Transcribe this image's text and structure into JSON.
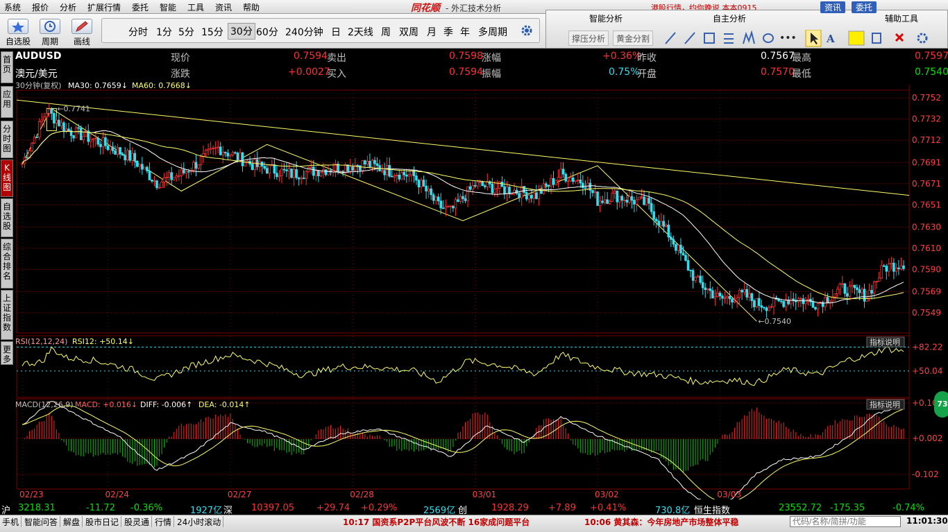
{
  "menu": [
    "系统",
    "报价",
    "分析",
    "扩展行情",
    "委托",
    "智能",
    "工具",
    "资讯",
    "帮助"
  ],
  "app": {
    "logo": "同花顺",
    "title": "- 外汇技术分析",
    "ticker": "港股行情，约你晚说  本本0915"
  },
  "toolbar": {
    "buttons": [
      "自选股",
      "周期",
      "画线"
    ],
    "periods": [
      "分时",
      "1分",
      "5分",
      "15分",
      "30分",
      "60分",
      "240分钟",
      "日",
      "2天线",
      "周",
      "双周",
      "月",
      "季",
      "年",
      "多周期"
    ],
    "active_period": "30分"
  },
  "rpanel": {
    "headers": [
      "智能分析",
      "自主分析",
      "辅助工具"
    ],
    "subbuttons": [
      "撑压分析",
      "黄金分割"
    ],
    "top_buttons": [
      "资讯",
      "委托"
    ]
  },
  "left_tabs": [
    "首页",
    "应用",
    "分时图",
    "K线图",
    "自选股",
    "综合排名",
    "上证指数",
    "更多"
  ],
  "quote": {
    "symbol": "AUDUSD",
    "name": "澳元/美元",
    "row1": [
      {
        "label": "现价",
        "value": "0.7594"
      },
      {
        "label": "卖出",
        "value": "0.7598"
      },
      {
        "label": "涨幅",
        "value": "+0.36%"
      },
      {
        "label": "昨收",
        "value": "0.7567"
      },
      {
        "label": "最高",
        "value": "0.7597"
      }
    ],
    "row2": [
      {
        "label": "涨跌",
        "value": "+0.0027"
      },
      {
        "label": "买入",
        "value": "0.7594"
      },
      {
        "label": "振幅",
        "value": "0.75%"
      },
      {
        "label": "开盘",
        "value": "0.7570"
      },
      {
        "label": "最低",
        "value": "0.7540"
      }
    ]
  },
  "colors": {
    "up": "#ff3030",
    "down": "#33ddee",
    "ma30": "#ffffff",
    "ma60": "#ffff66",
    "grid": "#7a0000",
    "macd_up": "#ff2020",
    "macd_down": "#00c000"
  },
  "chart_data": [
    {
      "type": "candlestick",
      "title": "30分钟(复权)",
      "indicators": [
        {
          "name": "MA30",
          "value": "0.7659"
        },
        {
          "name": "MA60",
          "value": "0.7668"
        }
      ],
      "y_ticks": [
        "0.7752",
        "0.7732",
        "0.7712",
        "0.7691",
        "0.7671",
        "0.7651",
        "0.7630",
        "0.7610",
        "0.7590",
        "0.7569",
        "0.7549"
      ],
      "ylim": [
        0.753,
        0.7758
      ],
      "x_ticks": [
        "02/23",
        "02/24",
        "02/27",
        "02/28",
        "03/01",
        "03/02",
        "03/03"
      ],
      "high_label": "0.7741",
      "low_label": "0.7540",
      "close_anchors": [
        [
          0,
          0.769
        ],
        [
          5,
          0.7715
        ],
        [
          10,
          0.774
        ],
        [
          18,
          0.7722
        ],
        [
          30,
          0.7712
        ],
        [
          45,
          0.7695
        ],
        [
          55,
          0.7672
        ],
        [
          65,
          0.768
        ],
        [
          80,
          0.7705
        ],
        [
          95,
          0.7688
        ],
        [
          110,
          0.768
        ],
        [
          125,
          0.7685
        ],
        [
          140,
          0.769
        ],
        [
          150,
          0.7683
        ],
        [
          160,
          0.7678
        ],
        [
          170,
          0.765
        ],
        [
          175,
          0.7645
        ],
        [
          185,
          0.767
        ],
        [
          200,
          0.7665
        ],
        [
          210,
          0.766
        ],
        [
          220,
          0.768
        ],
        [
          230,
          0.7672
        ],
        [
          235,
          0.7655
        ],
        [
          242,
          0.766
        ],
        [
          248,
          0.7656
        ],
        [
          255,
          0.7652
        ],
        [
          265,
          0.762
        ],
        [
          275,
          0.758
        ],
        [
          285,
          0.7562
        ],
        [
          295,
          0.7566
        ],
        [
          300,
          0.7558
        ],
        [
          305,
          0.7556
        ],
        [
          315,
          0.7563
        ],
        [
          325,
          0.7558
        ],
        [
          335,
          0.7572
        ],
        [
          345,
          0.7565
        ],
        [
          352,
          0.7592
        ],
        [
          360,
          0.7596
        ]
      ]
    },
    {
      "type": "line",
      "title": "RSI(12,12,24)",
      "series": [
        {
          "name": "RSI12",
          "value": "+50.14"
        }
      ],
      "y_ticks": [
        "+82.22",
        "+50.04"
      ],
      "button": "指标说明",
      "anchors": [
        [
          0,
          60
        ],
        [
          8,
          62
        ],
        [
          12,
          80
        ],
        [
          18,
          68
        ],
        [
          30,
          64
        ],
        [
          45,
          52
        ],
        [
          55,
          38
        ],
        [
          70,
          58
        ],
        [
          85,
          72
        ],
        [
          100,
          60
        ],
        [
          115,
          44
        ],
        [
          130,
          56
        ],
        [
          145,
          55
        ],
        [
          160,
          50
        ],
        [
          170,
          36
        ],
        [
          182,
          64
        ],
        [
          195,
          58
        ],
        [
          210,
          46
        ],
        [
          220,
          72
        ],
        [
          235,
          55
        ],
        [
          248,
          48
        ],
        [
          262,
          44
        ],
        [
          276,
          35
        ],
        [
          290,
          38
        ],
        [
          300,
          34
        ],
        [
          312,
          52
        ],
        [
          325,
          45
        ],
        [
          338,
          66
        ],
        [
          345,
          70
        ],
        [
          352,
          80
        ],
        [
          360,
          77
        ]
      ]
    },
    {
      "type": "bar+line",
      "title": "MACD(12,26,9)",
      "series": [
        {
          "name": "MACD",
          "value": "+0.016"
        },
        {
          "name": "DIFF",
          "value": "-0.006"
        },
        {
          "name": "DEA",
          "value": "-0.014"
        }
      ],
      "y_ticks": [
        "+0.104",
        "+0.002",
        "-0.102"
      ],
      "button": "指标说明",
      "diff_anchors": [
        [
          0,
          0.04
        ],
        [
          12,
          0.11
        ],
        [
          25,
          0.06
        ],
        [
          40,
          0.005
        ],
        [
          55,
          -0.09
        ],
        [
          70,
          -0.04
        ],
        [
          85,
          0.045
        ],
        [
          100,
          0.02
        ],
        [
          115,
          -0.03
        ],
        [
          130,
          0.015
        ],
        [
          145,
          0.03
        ],
        [
          160,
          -0.01
        ],
        [
          175,
          -0.05
        ],
        [
          190,
          0.04
        ],
        [
          205,
          -0.01
        ],
        [
          220,
          0.065
        ],
        [
          235,
          0.01
        ],
        [
          248,
          -0.025
        ],
        [
          260,
          -0.06
        ],
        [
          270,
          -0.14
        ],
        [
          280,
          -0.19
        ],
        [
          290,
          -0.17
        ],
        [
          300,
          -0.1
        ],
        [
          310,
          -0.06
        ],
        [
          325,
          -0.05
        ],
        [
          338,
          0.01
        ],
        [
          348,
          0.07
        ],
        [
          360,
          0.1
        ]
      ]
    }
  ],
  "status": {
    "sh_label": "沪",
    "sh_index": "3218.31",
    "sh_chg": "-11.72",
    "sh_pct": "-0.36%",
    "sh_amt": "1927亿",
    "sz_label": "深",
    "sz_index": "10397.05",
    "sz_chg": "+29.74",
    "sz_pct": "+0.29%",
    "sz_amt": "2569亿",
    "cy_label": "创",
    "cy_index": "1928.29",
    "cy_chg": "+7.89",
    "cy_pct": "+0.41%",
    "cy_amt": "730.8亿",
    "hs_label": "恒生指数",
    "hs_index": "23552.72",
    "hs_chg": "-175.35",
    "hs_pct": "-0.74%"
  },
  "bottom": {
    "buttons": [
      "手机",
      "智能问答",
      "解盘",
      "股市日记",
      "股灵通",
      "行情",
      "24小时滚动"
    ],
    "news1": "10:17 国资系P2P平台风波不断 16家成问题平台",
    "news2": "10:06 黄其森：今年房地产市场整体平稳",
    "search_placeholder": "代码/名称/简拼/功能",
    "clock": "11:01:30"
  },
  "badge": "73"
}
